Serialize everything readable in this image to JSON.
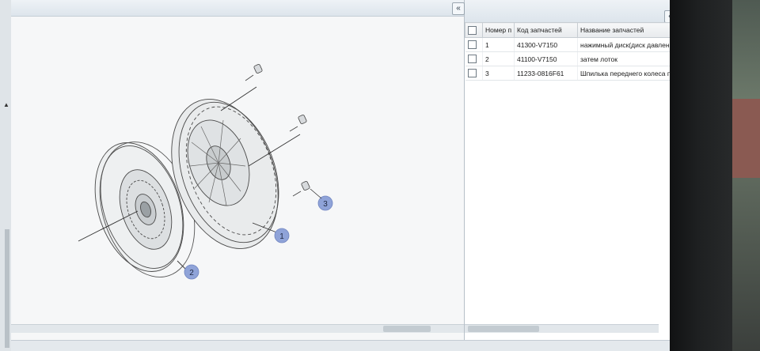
{
  "diagram": {
    "collapse_label": "«",
    "callouts": [
      {
        "id": "1",
        "label": "1"
      },
      {
        "id": "2",
        "label": "2"
      },
      {
        "id": "3",
        "label": "3"
      }
    ]
  },
  "parts_panel": {
    "collapse_label": "«",
    "columns": [
      "",
      "Номер п",
      "Код запчастей",
      "Название запчастей"
    ],
    "rows": [
      {
        "num": "1",
        "code": "41300-V7150",
        "name": "нажимный диск(диск давлен..."
      },
      {
        "num": "2",
        "code": "41100-V7150",
        "name": "затем лоток"
      },
      {
        "num": "3",
        "code": "11233-0816F61",
        "name": "Шпилька переднего колеса п"
      }
    ]
  },
  "left_panel": {
    "collapse_label": "▲"
  },
  "colors": {
    "callout_fill": "#8fa3d8",
    "accent": "#2b3a48"
  }
}
